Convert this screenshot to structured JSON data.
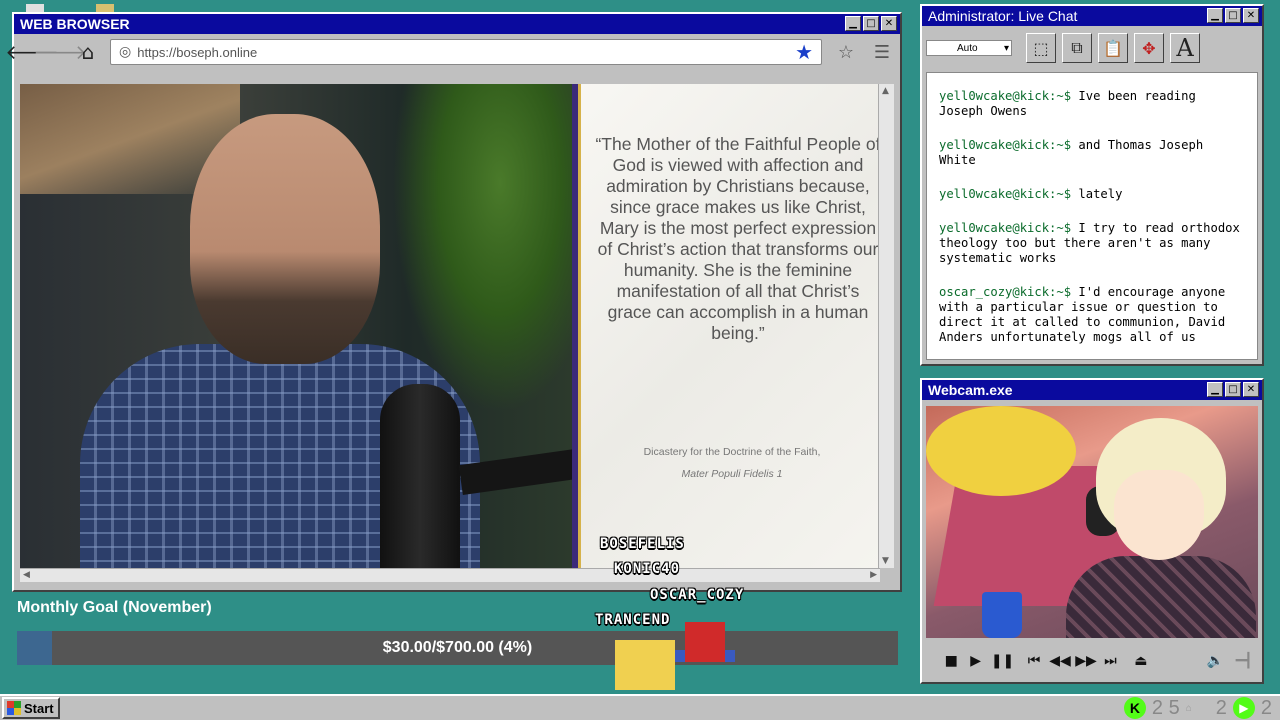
{
  "browser": {
    "title": "WEB BROWSER",
    "url": "https://boseph.online",
    "nav": {
      "back_icon": "arrow-left-icon",
      "forward_icon": "arrow-right-icon",
      "home_icon": "home-icon"
    },
    "slide": {
      "quote": "“The Mother of the Faithful People of God is viewed with affection and admiration by Christians because, since grace makes us like Christ, Mary is the most perfect expression of Christ’s action that transforms our humanity. She is the feminine manifestation of all that Christ’s grace can accomplish in a human being.”",
      "cite_line1": "Dicastery for the Doctrine of the Faith,",
      "cite_line2": "Mater Populi Fidelis 1"
    }
  },
  "chat": {
    "title": "Administrator: Live Chat",
    "select_value": "Auto",
    "messages": [
      {
        "user": "yell0wcake@kick:~$",
        "text": " Ive been reading Joseph Owens"
      },
      {
        "user": "yell0wcake@kick:~$",
        "text": " and Thomas Joseph White"
      },
      {
        "user": "yell0wcake@kick:~$",
        "text": " lately"
      },
      {
        "user": "yell0wcake@kick:~$",
        "text": " I try to read orthodox theology too but there aren't as many systematic works"
      },
      {
        "user": "oscar_cozy@kick:~$",
        "text": " I'd encourage anyone with a particular issue or question to direct it at called to communion, David Anders unfortunately mogs all of us"
      }
    ]
  },
  "webcam": {
    "title": "Webcam.exe"
  },
  "goal": {
    "title": "Monthly Goal (November)",
    "text": "$30.00/$700.00 (4%)",
    "progress": 0.04
  },
  "stream_names": [
    "BOSEFELIS",
    "KONIC40",
    "OSCAR_COZY",
    "TRANCEND"
  ],
  "taskbar": {
    "start_label": "Start",
    "tray_left": "2 5",
    "tray_right": "2",
    "tray_far": "2"
  },
  "colors": {
    "desktop": "#2e8f87",
    "titlebar": "#0a0a9e",
    "chat_user": "#0a6b2b",
    "goal_fill": "#3d6790",
    "kick_green": "#53fc18"
  }
}
